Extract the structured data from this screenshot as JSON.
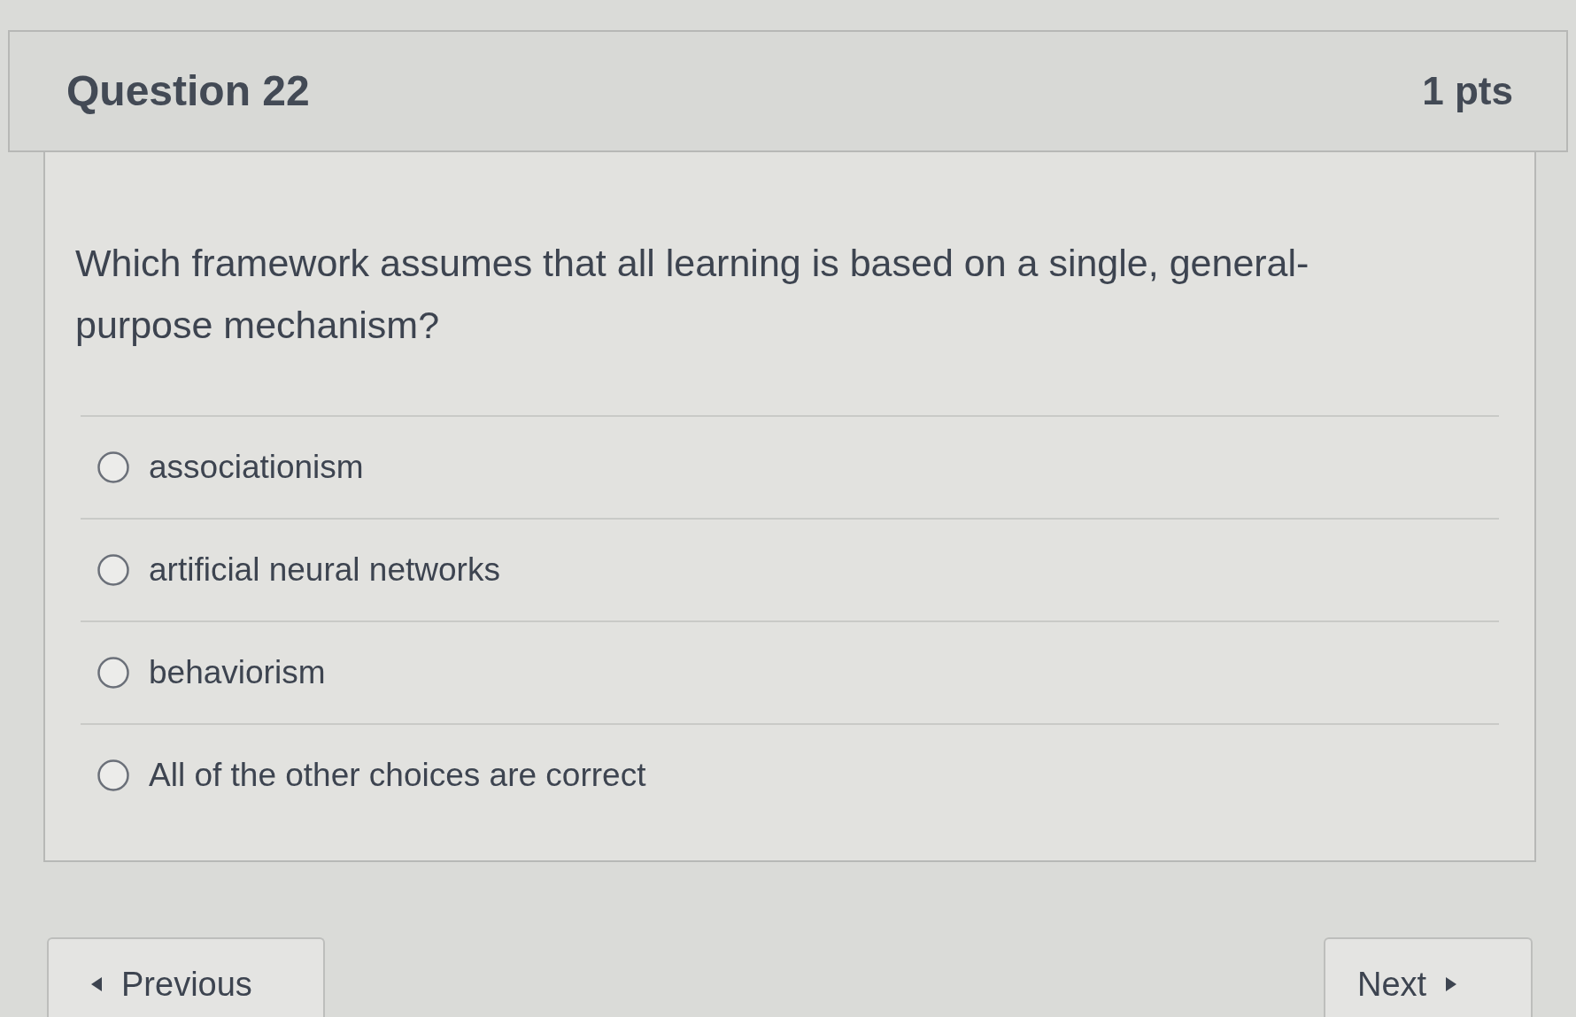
{
  "question": {
    "title": "Question 22",
    "points": "1 pts",
    "text": "Which framework assumes that all learning is based on a single, general-purpose mechanism?"
  },
  "answers": [
    {
      "label": "associationism",
      "selected": false
    },
    {
      "label": "artificial neural networks",
      "selected": false
    },
    {
      "label": "behaviorism",
      "selected": false
    },
    {
      "label": "All of the other choices are correct",
      "selected": false
    }
  ],
  "navigation": {
    "previous": "Previous",
    "next": "Next"
  }
}
